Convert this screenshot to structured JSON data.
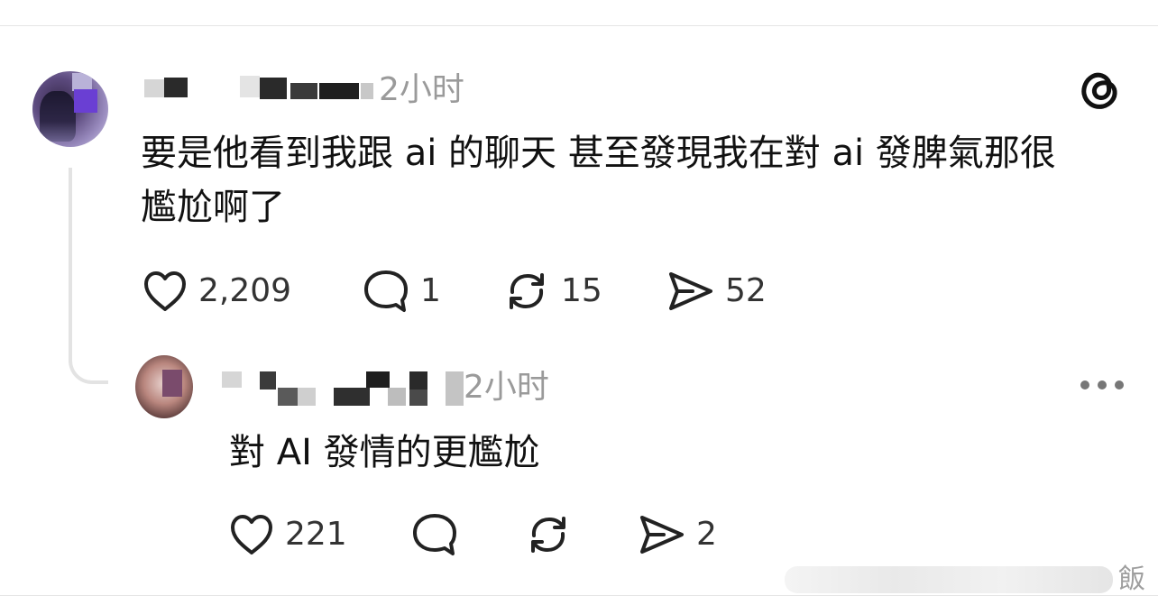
{
  "post": {
    "time": "2小时",
    "text_line1": "要是他看到我跟 ai 的聊天 甚至發現我在對 ai 發脾氣那很",
    "text_line2": "尷尬啊了",
    "likes": "2,209",
    "replies": "1",
    "reposts": "15",
    "shares": "52"
  },
  "reply": {
    "time": "2小时",
    "text": "對 AI 發情的更尷尬",
    "likes": "221",
    "shares": "2"
  },
  "icons": {
    "logo": "threads-logo-icon",
    "like": "heart-icon",
    "reply": "comment-bubble-icon",
    "repost": "repost-icon",
    "share": "send-icon",
    "more": "more-dots-icon"
  },
  "watermark": {
    "text": "飯"
  }
}
